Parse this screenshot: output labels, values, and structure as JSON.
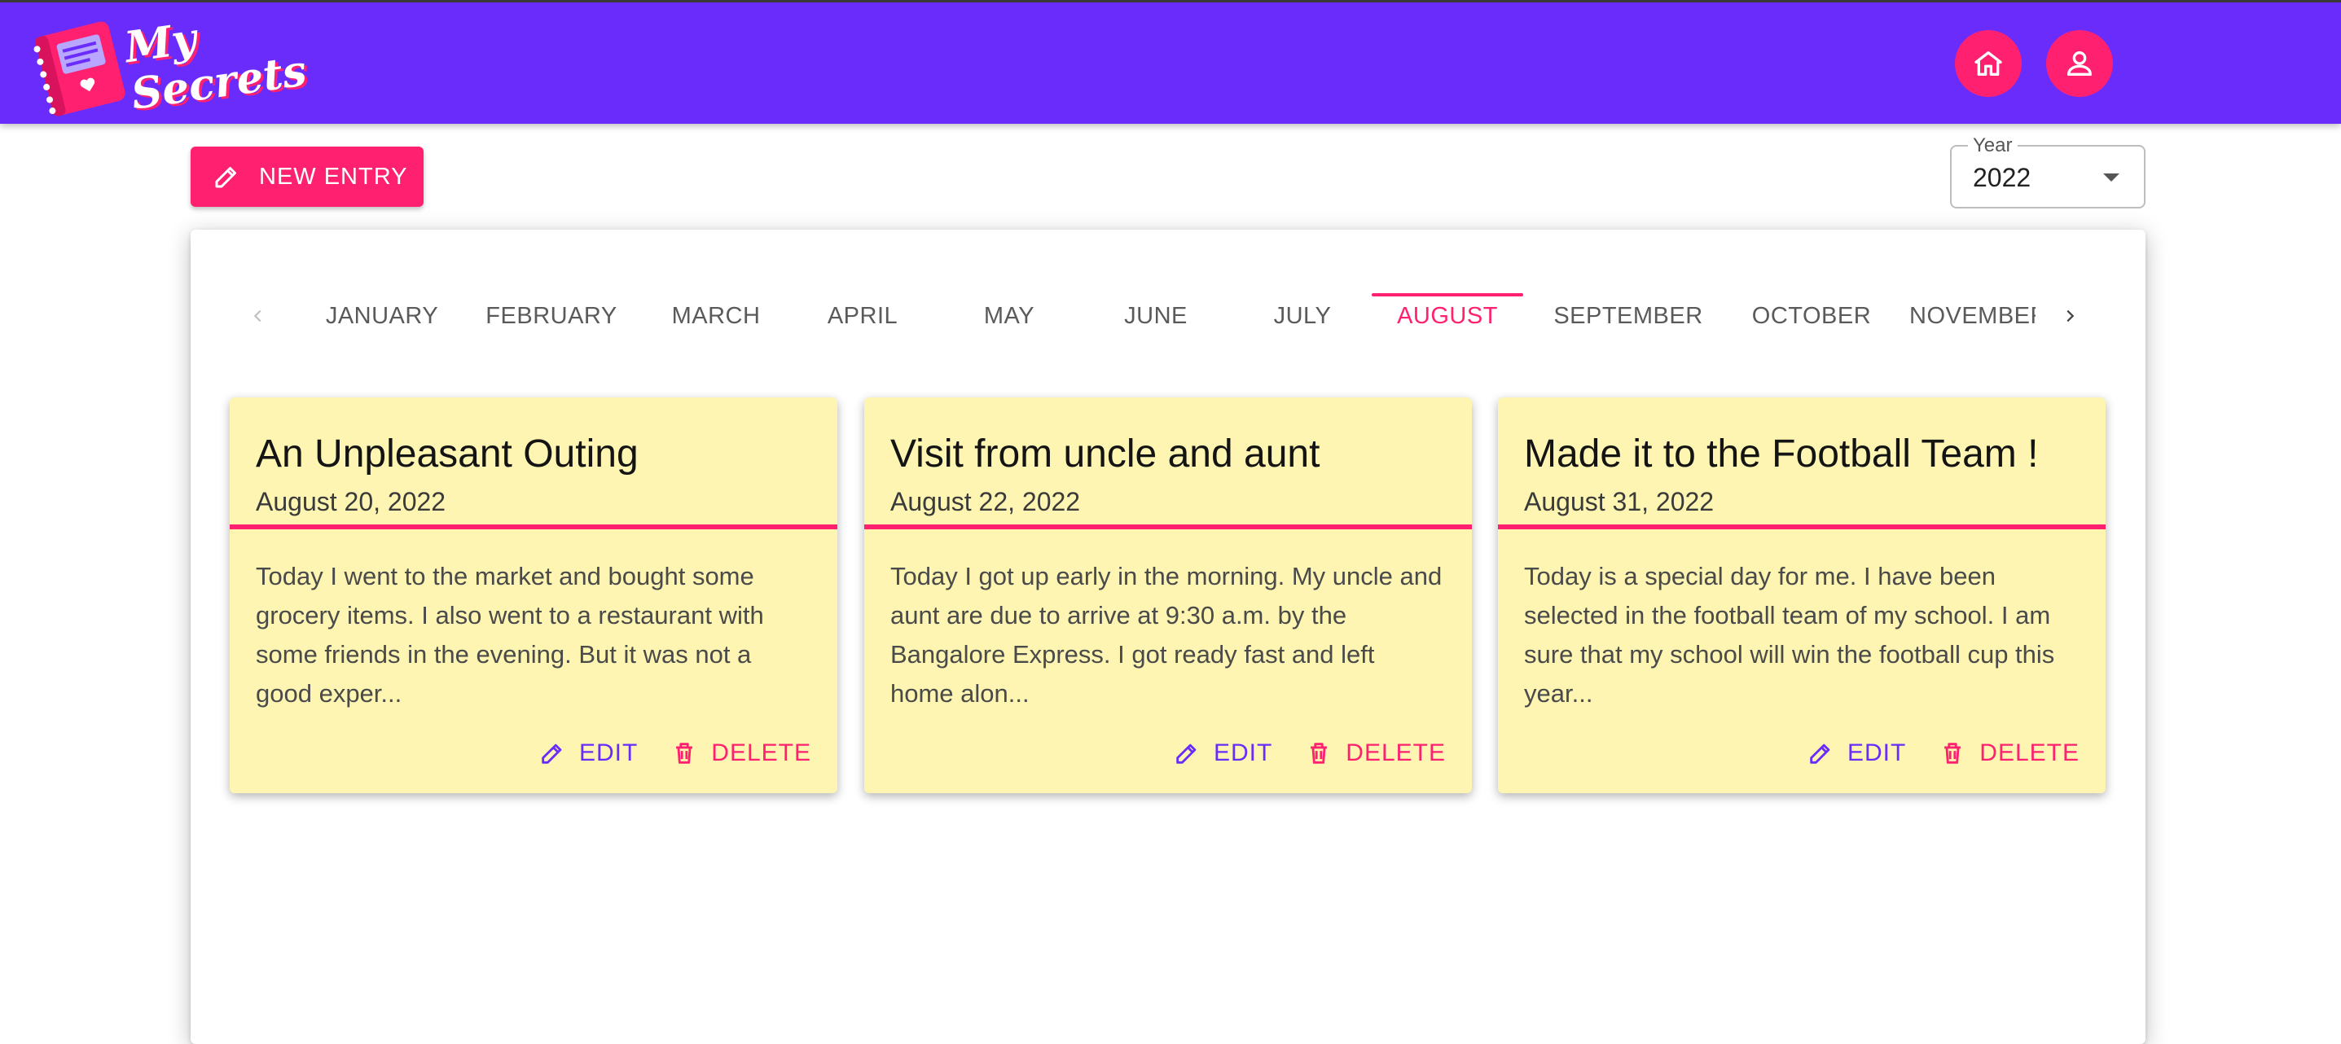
{
  "app": {
    "name": "My Secrets"
  },
  "header": {
    "home_icon": "home-icon",
    "profile_icon": "person-icon"
  },
  "toolbar": {
    "new_entry_label": "NEW ENTRY",
    "year_label": "Year",
    "year_value": "2022"
  },
  "months": [
    "JANUARY",
    "FEBRUARY",
    "MARCH",
    "APRIL",
    "MAY",
    "JUNE",
    "JULY",
    "AUGUST",
    "SEPTEMBER",
    "OCTOBER",
    "NOVEMBER"
  ],
  "active_month": "AUGUST",
  "entries": [
    {
      "title": "An Unpleasant Outing",
      "date": "August 20, 2022",
      "text": "Today I went to the market and bought some grocery items. I also went to a restaurant with some friends in the evening. But it was not a good exper...",
      "edit_label": "EDIT",
      "delete_label": "DELETE"
    },
    {
      "title": "Visit from uncle and aunt",
      "date": "August 22, 2022",
      "text": "Today I got up early in the morning. My uncle and aunt are due to arrive at 9:30 a.m. by the Bangalore Express. I got ready fast and left home alon...",
      "edit_label": "EDIT",
      "delete_label": "DELETE"
    },
    {
      "title": "Made it to the Football Team !",
      "date": "August 31, 2022",
      "text": "Today is a special day for me. I have been selected in the football team of my school. I am sure that my school will win the football cup this year...",
      "edit_label": "EDIT",
      "delete_label": "DELETE"
    }
  ],
  "colors": {
    "primary": "#6a2cfb",
    "accent": "#ff2170",
    "card": "#fdf5b1"
  }
}
